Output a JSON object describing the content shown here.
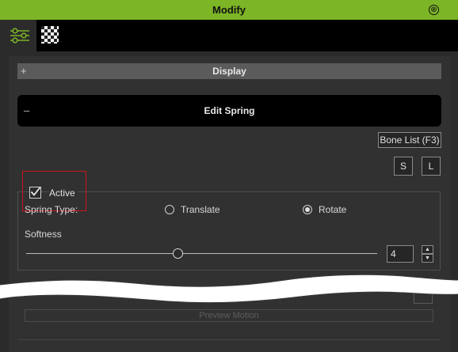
{
  "window": {
    "title": "Modify",
    "close_glyph": "⊗"
  },
  "tabs": [
    {
      "name": "modify",
      "icon": "sliders-icon",
      "active": true
    },
    {
      "name": "texture",
      "icon": "checker-icon",
      "active": false
    }
  ],
  "sections": {
    "display": {
      "toggle": "+",
      "label": "Display"
    },
    "edit_spring": {
      "toggle": "–",
      "label": "Edit Spring"
    }
  },
  "buttons": {
    "bone_list": "Bone List (F3)",
    "save": "S",
    "load": "L",
    "preview_motion": "Preview Motion"
  },
  "spring": {
    "active_label": "Active",
    "active_checked": true,
    "type_label": "Spring Type:",
    "options": [
      "Translate",
      "Rotate"
    ],
    "selected": "Rotate",
    "softness_label": "Softness",
    "softness_value": "4"
  },
  "colors": {
    "accent": "#7cb526",
    "highlight": "#c9151e",
    "panel": "#313131",
    "bar": "#000000"
  }
}
